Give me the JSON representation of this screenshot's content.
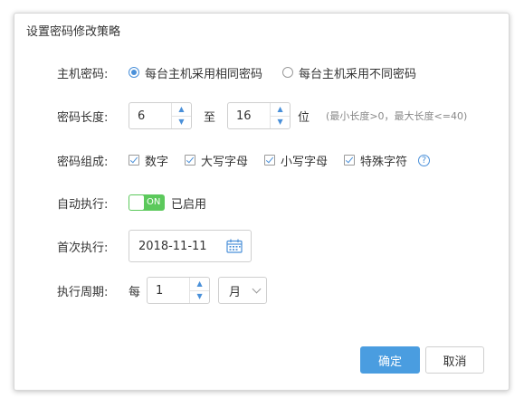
{
  "dialog": {
    "title": "设置密码修改策略"
  },
  "host_password": {
    "label": "主机密码:",
    "options": [
      {
        "label": "每台主机采用相同密码",
        "selected": true
      },
      {
        "label": "每台主机采用不同密码",
        "selected": false
      }
    ]
  },
  "password_length": {
    "label": "密码长度:",
    "min": "6",
    "to_label": "至",
    "max": "16",
    "unit": "位",
    "hint": "(最小长度>0，最大长度<=40)"
  },
  "password_composition": {
    "label": "密码组成:",
    "options": [
      {
        "label": "数字",
        "checked": true
      },
      {
        "label": "大写字母",
        "checked": true
      },
      {
        "label": "小写字母",
        "checked": true
      },
      {
        "label": "特殊字符",
        "checked": true
      }
    ],
    "help_glyph": "?"
  },
  "auto_execute": {
    "label": "自动执行:",
    "toggle_text": "ON",
    "enabled": true,
    "status": "已启用"
  },
  "first_execution": {
    "label": "首次执行:",
    "date": "2018-11-11"
  },
  "period": {
    "label": "执行周期:",
    "prefix": "每",
    "value": "1",
    "unit_selected": "月"
  },
  "buttons": {
    "ok": "确定",
    "cancel": "取消"
  },
  "colors": {
    "accent": "#4a90d9",
    "primary_button": "#4a9de0",
    "toggle_on": "#5cc95c"
  }
}
